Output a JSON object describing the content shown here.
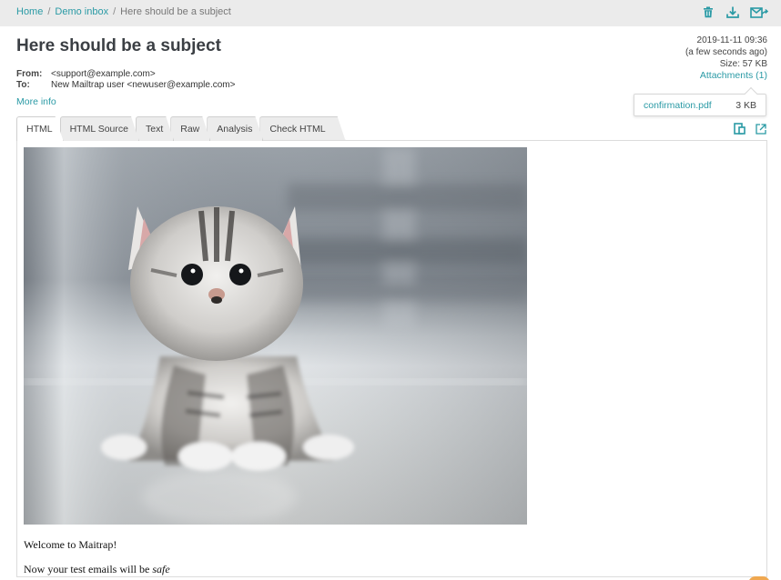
{
  "breadcrumb": {
    "home": "Home",
    "separator": "/",
    "inbox": "Demo inbox",
    "current": "Here should be a subject"
  },
  "toolbar": {
    "icons": [
      "trash-icon",
      "download-icon",
      "forward-email-icon"
    ],
    "accent_color": "#2a9aa5"
  },
  "message": {
    "subject": "Here should be a subject",
    "from_label": "From:",
    "from_value": "<support@example.com>",
    "to_label": "To:",
    "to_value": "New Mailtrap user <newuser@example.com>",
    "more_info": "More info",
    "date": "2019-11-11 09:36",
    "relative_time": "(a few seconds ago)",
    "size": "Size: 57 KB",
    "attachments_link": "Attachments (1)"
  },
  "attachments": [
    {
      "name": "confirmation.pdf",
      "size": "3 KB"
    }
  ],
  "tabs": [
    {
      "label": "HTML",
      "active": true
    },
    {
      "label": "HTML Source",
      "active": false
    },
    {
      "label": "Text",
      "active": false
    },
    {
      "label": "Raw",
      "active": false
    },
    {
      "label": "Analysis",
      "active": false
    },
    {
      "label": "Check HTML",
      "active": false
    }
  ],
  "tab_actions": [
    "mobile-preview-icon",
    "open-external-icon"
  ],
  "body": {
    "image_alt": "kitten",
    "line1": "Welcome to Maitrap!",
    "line2_prefix": "Now your test emails will be ",
    "line2_emphasis": "safe"
  }
}
